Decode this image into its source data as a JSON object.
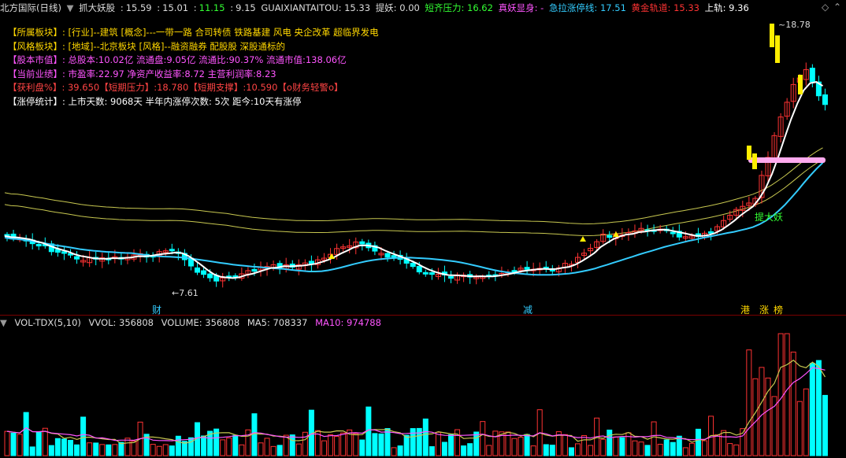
{
  "header": {
    "title": "北方国际(日线)",
    "indicator": "抓大妖股",
    "v1": "15.59",
    "v2": "15.01",
    "v3": "11.15",
    "v4": "9.15",
    "code_label": "GUAIXIANTAITOU: 15.33",
    "tiyao_label": "提妖: 0.00",
    "short_pressure_label": "短齐压力: 16.62",
    "zhenyao_label": "真妖显身: -",
    "jila_label": "急拉涨停线: 17.51",
    "gold_label": "黄金轨道: 15.33",
    "upper_label": "上轨: 9.36",
    "settings_icon": "diamond-icon",
    "collapse_icon": "chevron-up-icon"
  },
  "info_panel": [
    {
      "label": "【所属板块】",
      "value": ": [行业]--建筑 [概念]---一带一路 合司转债 铁路基建 风电 央企改革 超临界发电",
      "color": "#ffd700",
      "vcolor": "#ffd700"
    },
    {
      "label": "【风格板块】",
      "value": ": [地域]--北京板块 [风格]--融资融券 配股股 深股通标的",
      "color": "#ffd700",
      "vcolor": "#ffd700"
    },
    {
      "label": "【股本市值】",
      "value": ": 总股本:10.02亿 流通盘:9.05亿 流通比:90.37% 流通市值:138.06亿",
      "color": "#ff55ff",
      "vcolor": "#ff55ff"
    },
    {
      "label": "【当前业绩】",
      "value": ": 市盈率:22.97 净资产收益率:8.72 主营利润率:8.23",
      "color": "#ff55ff",
      "vcolor": "#ff55ff"
    },
    {
      "label": "【获利盘%】",
      "value": ": 39.650【短期压力】:18.780【短期支撑】:10.590【o财务轻警o】",
      "color": "#ff4444",
      "vcolor": "#ff4444"
    },
    {
      "label": "【涨停统计】",
      "value": ": 上市天数: 9068天 半年内涨停次数: 5次   距今:10天有涨停",
      "color": "#ffffff",
      "vcolor": "#ffffff"
    }
  ],
  "chart_labels": {
    "high_label": "18.78",
    "low_label": "7.61",
    "tiyao_text": "提大妖",
    "markers": [
      "财",
      "减",
      "港",
      "涨",
      "榜"
    ]
  },
  "volume_header": {
    "name": "VOL-TDX(5,10)",
    "vvol": "VVOL: 356808",
    "volume": "VOLUME: 356808",
    "ma5": "MA5: 708337",
    "ma10": "MA10: 974788"
  },
  "colors": {
    "up": "#ff3333",
    "down": "#00ffff",
    "ma_white": "#ffffff",
    "ma_cyan": "#33ccff",
    "ma_yellow": "#c8c850",
    "pink_bar": "#ffaaee",
    "gold_candle": "#ffee00"
  }
}
